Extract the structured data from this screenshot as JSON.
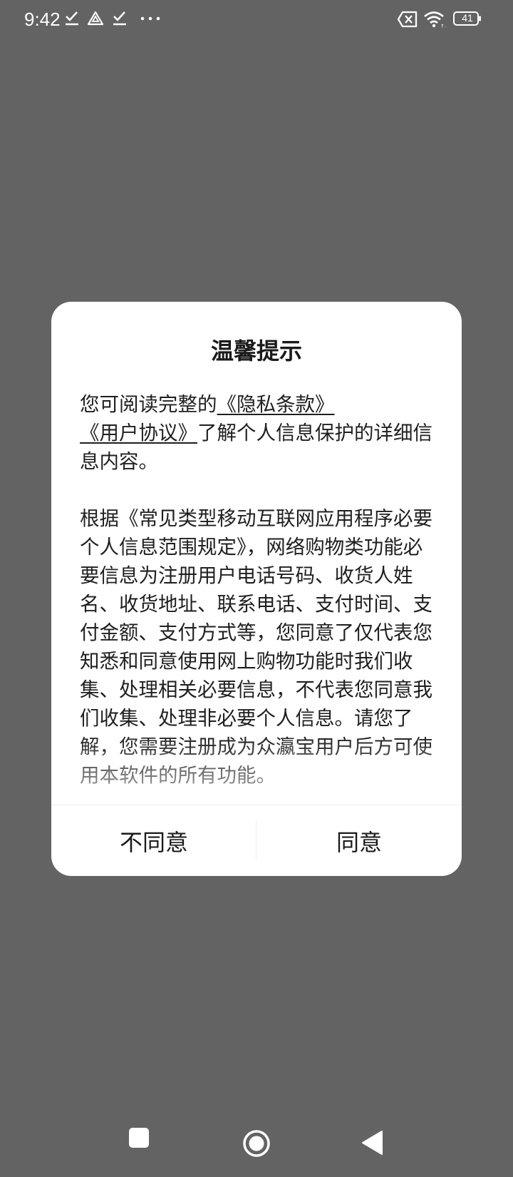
{
  "status_bar": {
    "time": "9:42",
    "battery": "41",
    "icons": [
      "check-icon",
      "drive-icon",
      "check-icon",
      "more-icon",
      "no-sim-icon",
      "wifi-icon",
      "battery-icon"
    ]
  },
  "dialog": {
    "title": "温馨提示",
    "para1_prefix": "您可阅读完整的",
    "privacy_link": "《隐私条款》",
    "user_agreement_link": "《用户协议》",
    "para1_suffix": "了解个人信息保护的详细信息内容。",
    "para2": "根据《常见类型移动互联网应用程序必要个人信息范围规定》，网络购物类功能必要信息为注册用户电话号码、收货人姓名、收货地址、联系电话、支付时间、支付金额、支付方式等，您同意了仅代表您知悉和同意使用网上购物功能时我们收集、处理相关必要信息，不代表您同意我们收集、处理非必要个人信息。请您了解，您需要注册成为众瀛宝用户后方可使用本软件的所有功能。",
    "disagree_label": "不同意",
    "agree_label": "同意"
  },
  "navigation": {
    "icons": [
      "recents-icon",
      "home-icon",
      "back-icon"
    ]
  },
  "colors": {
    "scrim": "#636363",
    "dialog_bg": "#ffffff",
    "text": "#1f1f1f",
    "divider": "#eeeeee"
  }
}
